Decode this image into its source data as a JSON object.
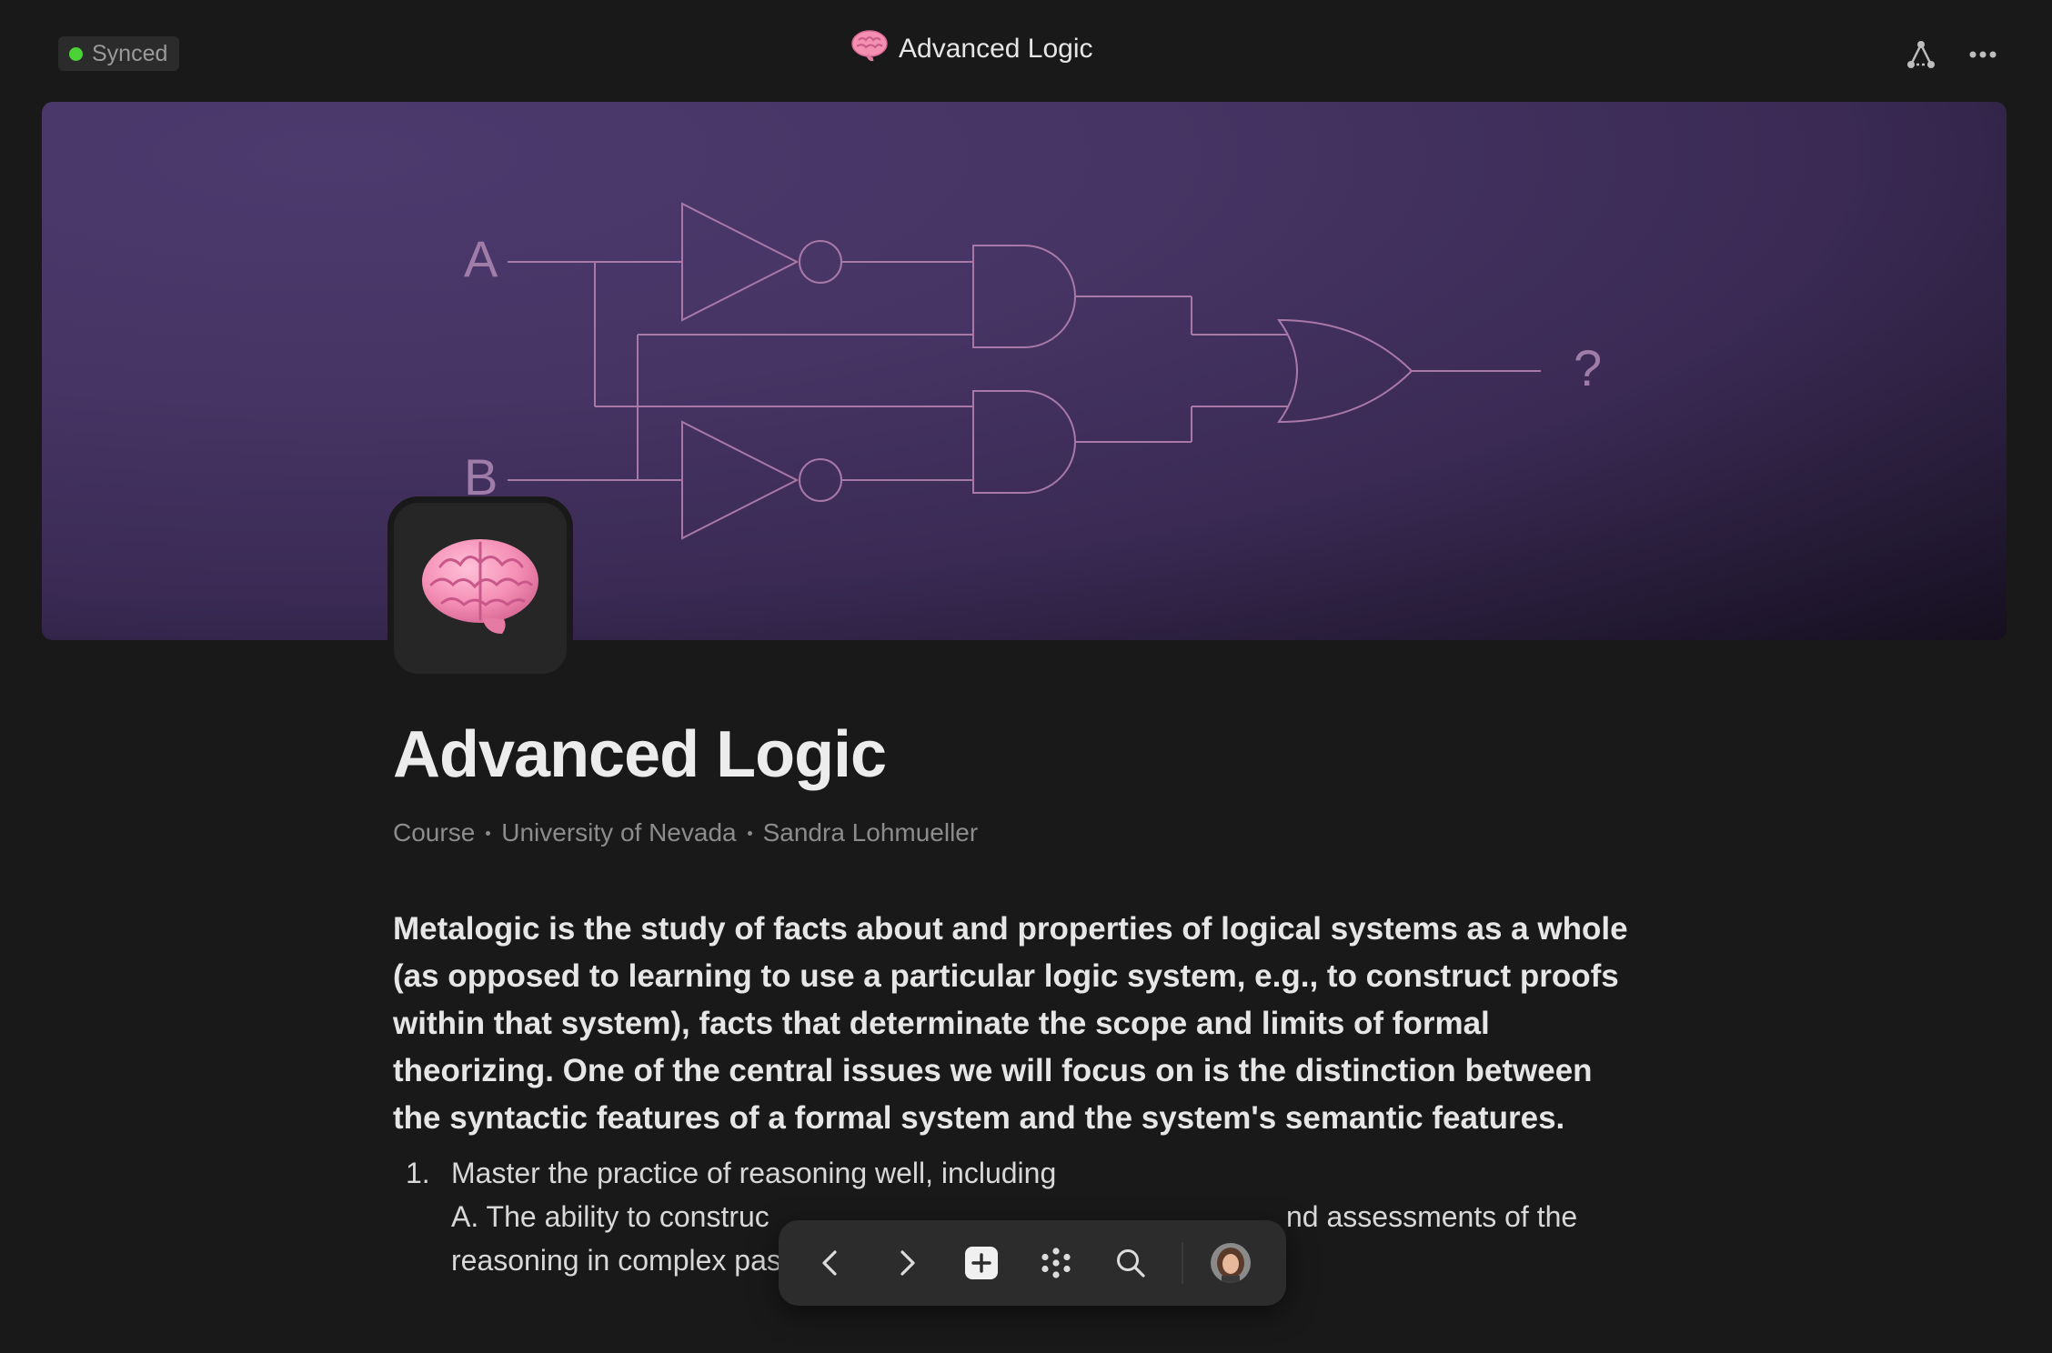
{
  "header": {
    "sync_status": "Synced",
    "window_title": "Advanced Logic",
    "title_icon": "brain-emoji",
    "graph_icon": "graph-icon",
    "more_icon": "more-icon"
  },
  "banner": {
    "input_a": "A",
    "input_b": "B",
    "output": "?"
  },
  "page": {
    "icon": "brain-emoji",
    "title": "Advanced Logic",
    "meta": [
      "Course",
      "University of Nevada",
      "Sandra Lohmueller"
    ],
    "lead": "Metalogic is the study of facts about and properties of logical systems as a whole (as opposed to learning to use a particular logic system, e.g., to construct proofs within that system), facts that determinate the scope and limits of formal theorizing. One of the central issues we will focus on is the distinction between the syntactic features of a formal system and the system's semantic features.",
    "list": [
      {
        "number": "1.",
        "text": "Master the practice of reasoning well, including",
        "sub_line_1_start": "A. The ability to construc",
        "sub_line_1_end": "nd assessments of the",
        "sub_line_2": "reasoning in complex passages by"
      }
    ]
  },
  "dock": {
    "items": [
      "back-icon",
      "forward-icon",
      "new-page-icon",
      "dots-grid-icon",
      "search-icon",
      "avatar"
    ]
  },
  "colors": {
    "background": "#191919",
    "sync_dot": "#4cd137",
    "banner_purple": "#4c3a6e",
    "circuit_line": "#b07ab0"
  }
}
